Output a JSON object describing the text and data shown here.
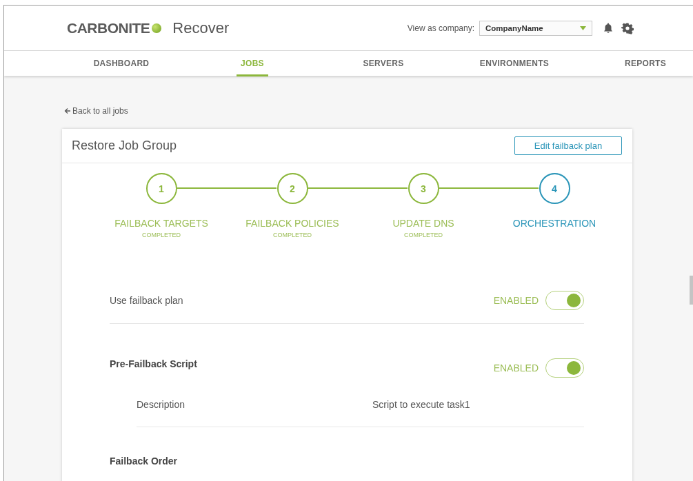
{
  "header": {
    "logo": "CARBONITE",
    "app_name": "Recover",
    "company_label": "View as company:",
    "company_select": {
      "value": "CompanyName"
    }
  },
  "nav": [
    {
      "label": "DASHBOARD",
      "selected": false
    },
    {
      "label": "JOBS",
      "selected": true
    },
    {
      "label": "SERVERS",
      "selected": false
    },
    {
      "label": "ENVIRONMENTS",
      "selected": false
    },
    {
      "label": "REPORTS",
      "selected": false
    }
  ],
  "back_link": "Back to all jobs",
  "card": {
    "title": "Restore Job Group",
    "button": "Edit failback plan",
    "steps": [
      {
        "number": "1",
        "label": "FAILBACK TARGETS",
        "status": "COMPLETED",
        "completed": true,
        "current": false
      },
      {
        "number": "2",
        "label": "FAILBACK POLICIES",
        "status": "COMPLETED",
        "completed": true,
        "current": false
      },
      {
        "number": "3",
        "label": "UPDATE DNS",
        "status": "COMPLETED",
        "completed": true,
        "current": false
      },
      {
        "number": "4",
        "label": "ORCHESTRATION",
        "completed": false,
        "current": true
      }
    ],
    "settings": [
      {
        "kind": "toggle",
        "label": "Use failback plan",
        "toggle_label": "ENABLED",
        "on": true
      },
      {
        "kind": "section_toggle",
        "label": "Pre-Failback Script",
        "toggle_label": "ENABLED",
        "on": true
      },
      {
        "kind": "detail",
        "label": "Description",
        "value": "Script to execute task1"
      },
      {
        "kind": "section",
        "label": "Failback Order"
      }
    ]
  }
}
